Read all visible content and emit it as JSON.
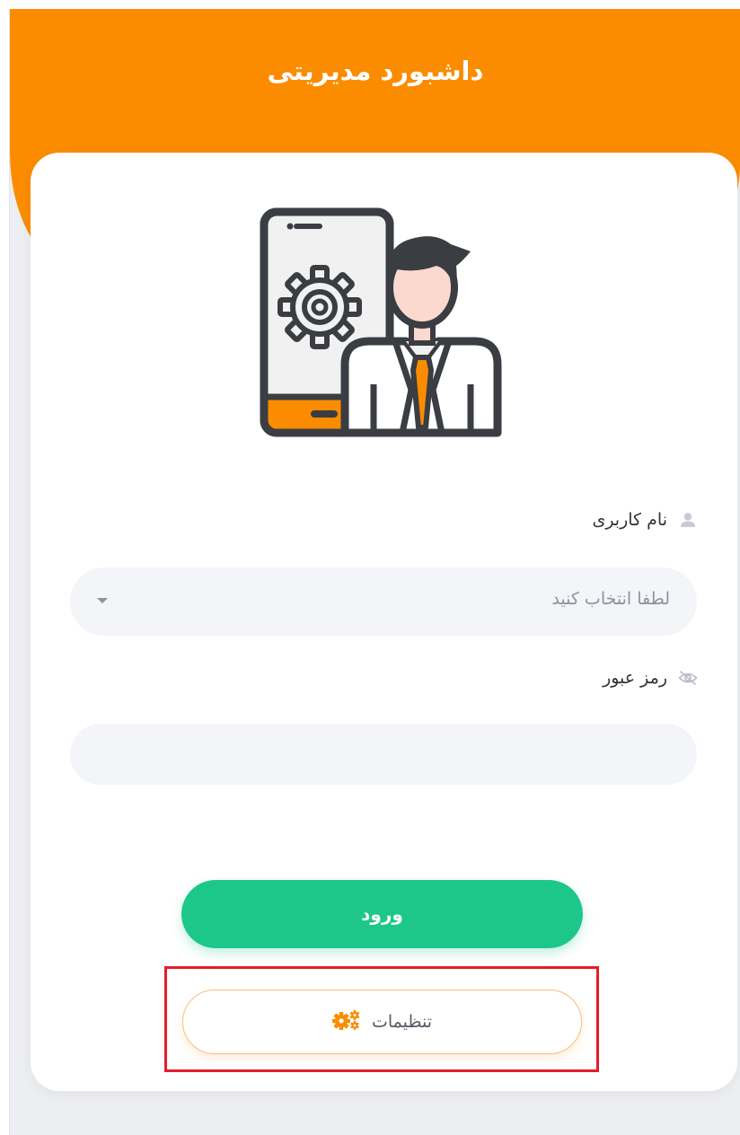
{
  "app": {
    "title": "داشبورد مدیریتی"
  },
  "login_form": {
    "username_label": "نام کاربری",
    "username_icon": "user-icon",
    "username_select_placeholder": "لطفا انتخاب کنید",
    "password_label": "رمز عبور",
    "password_icon": "eye-slash-icon",
    "password_value": "",
    "login_button_label": "ورود",
    "settings_button_label": "تنظیمات",
    "settings_icon": "gears-icon"
  },
  "illustration": {
    "icon": "admin-settings-illustration"
  },
  "colors": {
    "brand_orange": "#fb8c00",
    "login_green": "#1dc78a",
    "highlight_red": "#e51c2a",
    "card_background": "#ffffff",
    "page_background": "#edeef2"
  }
}
